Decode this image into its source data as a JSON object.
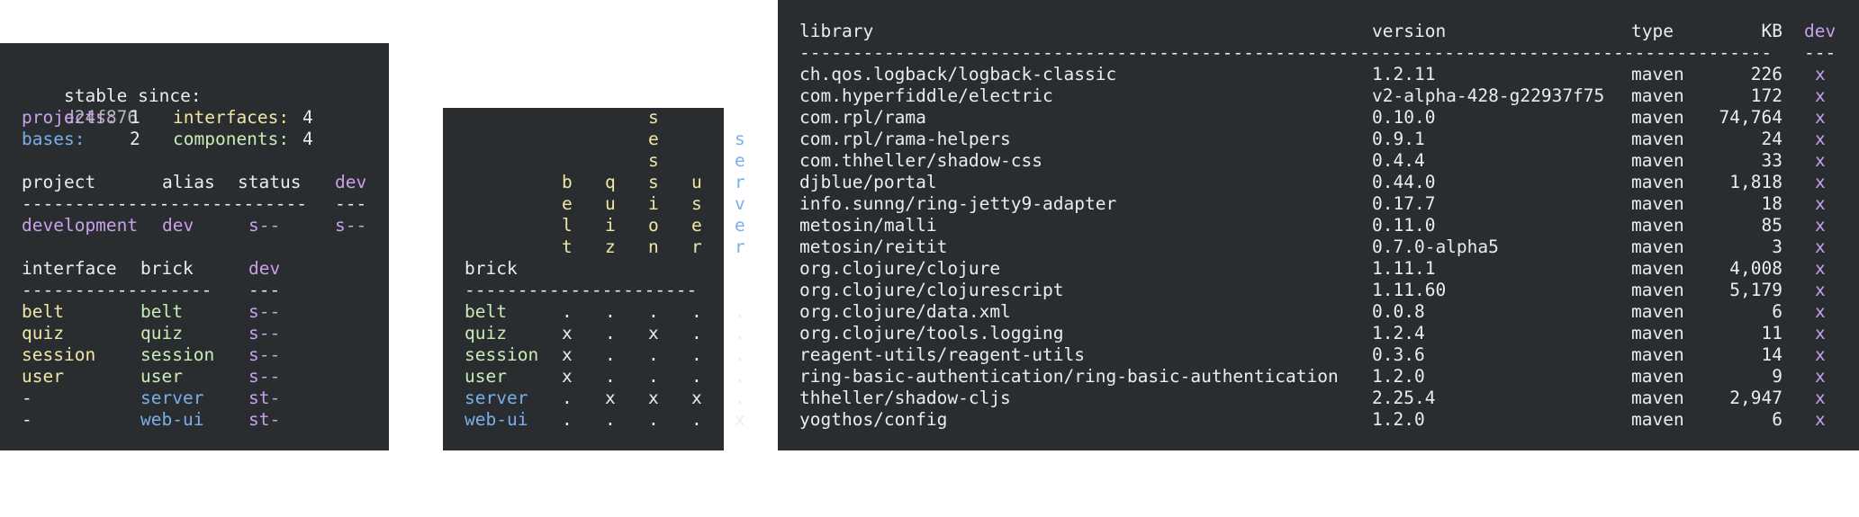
{
  "info_panel": {
    "stable_label": "stable since:",
    "stable_sha": "d24f876",
    "counts": {
      "projects_label": "projects:",
      "projects_value": "1",
      "interfaces_label": "interfaces:",
      "interfaces_value": "4",
      "bases_label": "bases:",
      "bases_value": "2",
      "components_label": "components:",
      "components_value": "4"
    },
    "project_table": {
      "headers": {
        "project": "project",
        "alias": "alias",
        "status": "status",
        "dev": "dev"
      },
      "separator_main": "---------------------------",
      "separator_dev": "---",
      "rows": [
        {
          "project": "development",
          "alias": "dev",
          "status": "s--",
          "dev": "s--"
        }
      ]
    },
    "brick_table": {
      "headers": {
        "interface": "interface",
        "brick": "brick",
        "dev": "dev"
      },
      "separator_main": "------------------",
      "separator_dev": "---",
      "rows": [
        {
          "interface": "belt",
          "brick": "belt",
          "dev": "s--"
        },
        {
          "interface": "quiz",
          "brick": "quiz",
          "dev": "s--"
        },
        {
          "interface": "session",
          "brick": "session",
          "dev": "s--"
        },
        {
          "interface": "user",
          "brick": "user",
          "dev": "s--"
        },
        {
          "interface": "-",
          "brick": "server",
          "dev": "st-"
        },
        {
          "interface": "-",
          "brick": "web-ui",
          "dev": "st-"
        }
      ]
    }
  },
  "deps_panel": {
    "brick_header": "brick",
    "separator": "----------------------",
    "columns": [
      {
        "letters": [
          "b",
          "e",
          "l",
          "t"
        ],
        "color": "yellow"
      },
      {
        "letters": [
          "q",
          "u",
          "i",
          "z"
        ],
        "color": "yellow"
      },
      {
        "letters": [
          "s",
          "e",
          "s",
          "s",
          "i",
          "o",
          "n"
        ],
        "color": "yellow"
      },
      {
        "letters": [
          "u",
          "s",
          "e",
          "r"
        ],
        "color": "yellow"
      },
      {
        "letters": [
          "s",
          "e",
          "r",
          "v",
          "e",
          "r"
        ],
        "color": "blue"
      }
    ],
    "rows": [
      {
        "brick": "belt",
        "color": "green",
        "cells": [
          ".",
          ".",
          ".",
          ".",
          ".",
          "."
        ]
      },
      {
        "brick": "quiz",
        "color": "green",
        "cells": [
          "x",
          ".",
          "x",
          ".",
          ".",
          ""
        ]
      },
      {
        "brick": "session",
        "color": "green",
        "cells": [
          "x",
          ".",
          ".",
          ".",
          ".",
          ""
        ]
      },
      {
        "brick": "user",
        "color": "green",
        "cells": [
          "x",
          ".",
          ".",
          ".",
          ".",
          ""
        ]
      },
      {
        "brick": "server",
        "color": "blue",
        "cells": [
          ".",
          "x",
          "x",
          "x",
          ".",
          ""
        ]
      },
      {
        "brick": "web-ui",
        "color": "blue",
        "cells": [
          ".",
          ".",
          ".",
          ".",
          "x",
          ""
        ]
      }
    ]
  },
  "libs_panel": {
    "headers": {
      "library": "library",
      "version": "version",
      "type": "type",
      "kb": "KB",
      "dev": "dev"
    },
    "separator_main": "--------------------------------------------------------------------------------------------",
    "separator_dev": "---",
    "rows": [
      {
        "library": "ch.qos.logback/logback-classic",
        "version": "1.2.11",
        "type": "maven",
        "kb": "226",
        "dev": "x"
      },
      {
        "library": "com.hyperfiddle/electric",
        "version": "v2-alpha-428-g22937f75",
        "type": "maven",
        "kb": "172",
        "dev": "x"
      },
      {
        "library": "com.rpl/rama",
        "version": "0.10.0",
        "type": "maven",
        "kb": "74,764",
        "dev": "x"
      },
      {
        "library": "com.rpl/rama-helpers",
        "version": "0.9.1",
        "type": "maven",
        "kb": "24",
        "dev": "x"
      },
      {
        "library": "com.thheller/shadow-css",
        "version": "0.4.4",
        "type": "maven",
        "kb": "33",
        "dev": "x"
      },
      {
        "library": "djblue/portal",
        "version": "0.44.0",
        "type": "maven",
        "kb": "1,818",
        "dev": "x"
      },
      {
        "library": "info.sunng/ring-jetty9-adapter",
        "version": "0.17.7",
        "type": "maven",
        "kb": "18",
        "dev": "x"
      },
      {
        "library": "metosin/malli",
        "version": "0.11.0",
        "type": "maven",
        "kb": "85",
        "dev": "x"
      },
      {
        "library": "metosin/reitit",
        "version": "0.7.0-alpha5",
        "type": "maven",
        "kb": "3",
        "dev": "x"
      },
      {
        "library": "org.clojure/clojure",
        "version": "1.11.1",
        "type": "maven",
        "kb": "4,008",
        "dev": "x"
      },
      {
        "library": "org.clojure/clojurescript",
        "version": "1.11.60",
        "type": "maven",
        "kb": "5,179",
        "dev": "x"
      },
      {
        "library": "org.clojure/data.xml",
        "version": "0.0.8",
        "type": "maven",
        "kb": "6",
        "dev": "x"
      },
      {
        "library": "org.clojure/tools.logging",
        "version": "1.2.4",
        "type": "maven",
        "kb": "11",
        "dev": "x"
      },
      {
        "library": "reagent-utils/reagent-utils",
        "version": "0.3.6",
        "type": "maven",
        "kb": "14",
        "dev": "x"
      },
      {
        "library": "ring-basic-authentication/ring-basic-authentication",
        "version": "1.2.0",
        "type": "maven",
        "kb": "9",
        "dev": "x"
      },
      {
        "library": "thheller/shadow-cljs",
        "version": "2.25.4",
        "type": "maven",
        "kb": "2,947",
        "dev": "x"
      },
      {
        "library": "yogthos/config",
        "version": "1.2.0",
        "type": "maven",
        "kb": "6",
        "dev": "x"
      }
    ]
  }
}
